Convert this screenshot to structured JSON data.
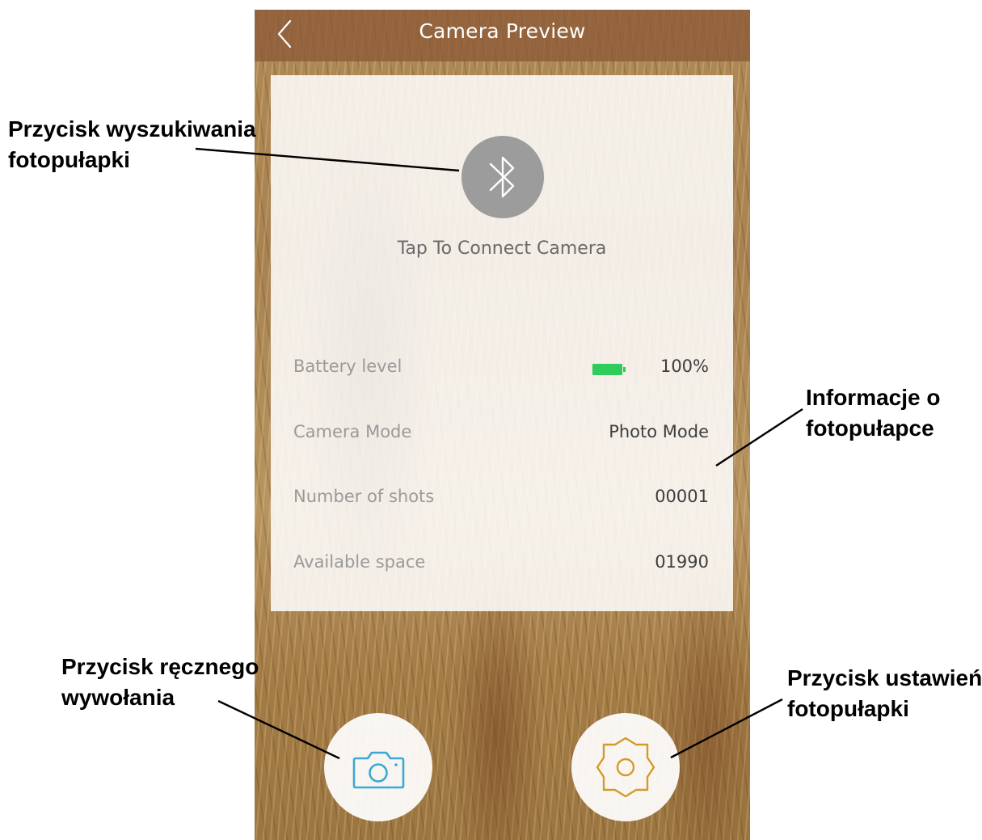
{
  "header": {
    "title": "Camera Preview",
    "back_icon": "chevron-left-icon"
  },
  "connect": {
    "icon": "bluetooth-icon",
    "label": "Tap To Connect Camera"
  },
  "info": {
    "battery": {
      "label": "Battery level",
      "value": "100%",
      "icon": "battery-icon",
      "level": 1.0,
      "color": "#2ecc5a"
    },
    "mode": {
      "label": "Camera Mode",
      "value": "Photo Mode"
    },
    "shots": {
      "label": "Number of shots",
      "value": "00001"
    },
    "space": {
      "label": "Available space",
      "value": "01990"
    }
  },
  "buttons": {
    "capture_icon": "camera-icon",
    "capture_color": "#3aa9d6",
    "settings_icon": "gear-icon",
    "settings_color": "#d49a2a"
  },
  "annotations": {
    "search_line1": "Przycisk wyszukiwania",
    "search_line2": "fotopułapki",
    "info_line1": "Informacje o",
    "info_line2": "fotopułapce",
    "manual_line1": "Przycisk ręcznego",
    "manual_line2": "wywołania",
    "settings_line1": "Przycisk ustawień",
    "settings_line2": "fotopułapki"
  }
}
